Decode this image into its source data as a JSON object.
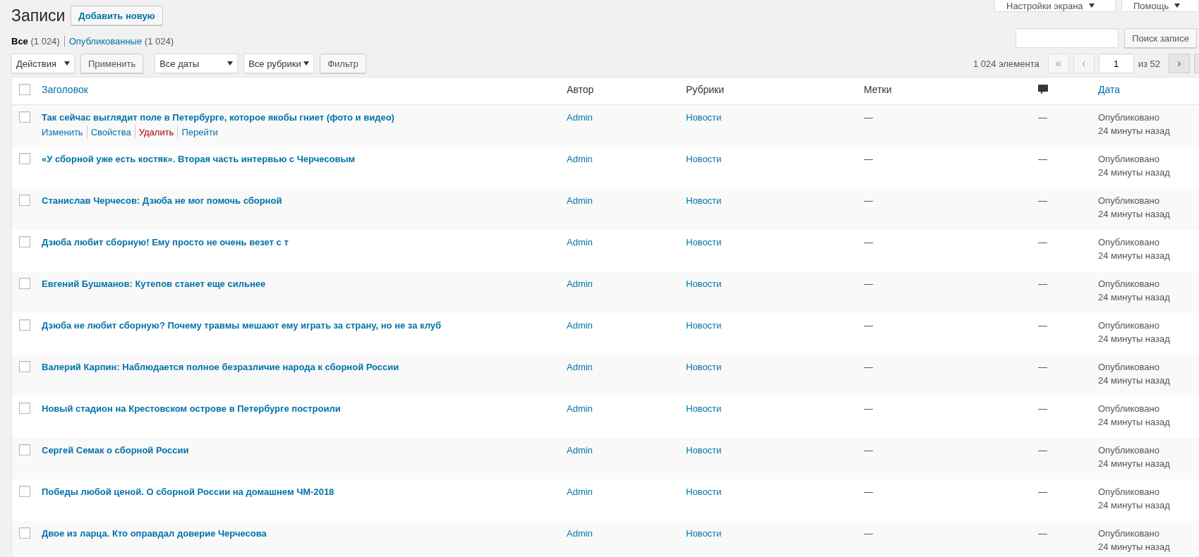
{
  "header": {
    "title": "Записи",
    "add_button": "Добавить новую",
    "screen_options": "Настройки экрана",
    "help": "Помощь"
  },
  "views": [
    {
      "label": "Все",
      "count": "(1 024)",
      "selected": true
    },
    {
      "label": "Опубликованные",
      "count": "(1 024)",
      "selected": false
    }
  ],
  "bulk_actions": {
    "select": "Действия",
    "apply": "Применить"
  },
  "filters": {
    "dates": "Все даты",
    "categories": "Все рубрики",
    "button": "Фильтр"
  },
  "search": {
    "button": "Поиск записе"
  },
  "pagination": {
    "count": "1 024 элемента",
    "page": "1",
    "total": "из 52",
    "buttons": [
      {
        "label": "«",
        "disabled": true
      },
      {
        "label": "‹",
        "disabled": true
      }
    ],
    "next_buttons": [
      {
        "label": "›",
        "disabled": false
      },
      {
        "disabled": false
      }
    ]
  },
  "table": {
    "select_all": {
      "checked": false
    },
    "columns": [
      {
        "kind": "checkbox"
      },
      {
        "kind": "sortable",
        "label": "Заголовок"
      },
      {
        "kind": "plain",
        "label": "Автор"
      },
      {
        "kind": "plain",
        "label": "Рубрики"
      },
      {
        "kind": "plain",
        "label": "Метки"
      },
      {
        "kind": "comments"
      },
      {
        "kind": "sortable",
        "label": "Дата"
      }
    ],
    "rows": [
      {
        "checked": false,
        "title": "Так сейчас выглядит поле в Петербурге, которое якобы гниет (фото и видео)",
        "author": "Admin",
        "category": "Новости",
        "tags": "—",
        "comments": "—",
        "status": "Опубликовано",
        "time": "24 минуты назад",
        "actions": [
          {
            "label": "Изменить",
            "kind": "link"
          },
          {
            "label": "Свойства",
            "kind": "link"
          },
          {
            "label": "Удалить",
            "kind": "danger"
          },
          {
            "label": "Перейти",
            "kind": "link"
          }
        ]
      },
      {
        "checked": false,
        "title": "«У сборной уже есть костяк». Вторая часть интервью с Черчесовым",
        "author": "Admin",
        "category": "Новости",
        "tags": "—",
        "comments": "—",
        "status": "Опубликовано",
        "time": "24 минуты назад"
      },
      {
        "checked": false,
        "title": "Станислав Черчесов: Дзюба не мог помочь сборной",
        "author": "Admin",
        "category": "Новости",
        "tags": "—",
        "comments": "—",
        "status": "Опубликовано",
        "time": "24 минуты назад"
      },
      {
        "checked": false,
        "title": "Дзюба любит сборную! Ему просто не очень везет с т",
        "author": "Admin",
        "category": "Новости",
        "tags": "—",
        "comments": "—",
        "status": "Опубликовано",
        "time": "24 минуты назад"
      },
      {
        "checked": false,
        "title": "Евгений Бушманов: Кутепов станет еще сильнее",
        "author": "Admin",
        "category": "Новости",
        "tags": "—",
        "comments": "—",
        "status": "Опубликовано",
        "time": "24 минуты назад"
      },
      {
        "checked": false,
        "title": "Дзюба не любит сборную? Почему травмы мешают ему играть за страну, но не за клуб",
        "author": "Admin",
        "category": "Новости",
        "tags": "—",
        "comments": "—",
        "status": "Опубликовано",
        "time": "24 минуты назад"
      },
      {
        "checked": false,
        "title": "Валерий Карпин: Наблюдается полное безразличие народа к сборной России",
        "author": "Admin",
        "category": "Новости",
        "tags": "—",
        "comments": "—",
        "status": "Опубликовано",
        "time": "24 минуты назад"
      },
      {
        "checked": false,
        "title": "Новый стадион на Крестовском острове в Петербурге построили",
        "author": "Admin",
        "category": "Новости",
        "tags": "—",
        "comments": "—",
        "status": "Опубликовано",
        "time": "24 минуты назад"
      },
      {
        "checked": false,
        "title": "Сергей Семак о сборной России",
        "author": "Admin",
        "category": "Новости",
        "tags": "—",
        "comments": "—",
        "status": "Опубликовано",
        "time": "24 минуты назад"
      },
      {
        "checked": false,
        "title": "Победы любой ценой. О сборной России на домашнем ЧМ-2018",
        "author": "Admin",
        "category": "Новости",
        "tags": "—",
        "comments": "—",
        "status": "Опубликовано",
        "time": "24 минуты назад"
      },
      {
        "checked": false,
        "title": "Двое из ларца. Кто оправдал доверие Черчесова",
        "author": "Admin",
        "category": "Новости",
        "tags": "—",
        "comments": "—",
        "status": "Опубликовано",
        "time": "24 минуты назад"
      }
    ]
  }
}
